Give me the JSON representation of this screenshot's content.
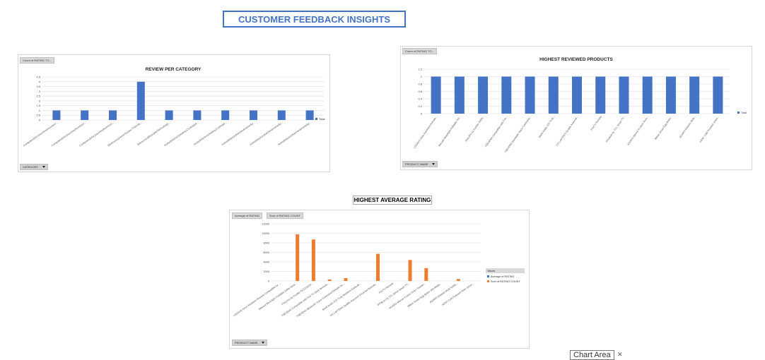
{
  "dashboard": {
    "title": "CUSTOMER FEEDBACK INSIGHTS",
    "third_chart_heading": "HIGHEST AVERAGE RATING",
    "tooltip": "Chart Area"
  },
  "colors": {
    "blue": "#4472c4",
    "orange": "#ed7d31",
    "grid": "#d9d9d9"
  },
  "chart_data": [
    {
      "type": "bar",
      "title": "REVIEW PER CATEGORY",
      "field_button": "Count of RATING TO...",
      "axis_button": "CATEGORY",
      "ylim": [
        0,
        4.5
      ],
      "yticks": [
        "0",
        "0.5",
        "1",
        "1.5",
        "2",
        "2.5",
        "3",
        "3.5",
        "4",
        "4.5"
      ],
      "categories": [
        "Computers&Accessories|Accessori...",
        "Computers&Accessories|Accessori...",
        "Computers&Accessories|Accessori...",
        "Electronics|HomeTheater,TV&Vide...",
        "Electronics|WearableTechnology|...",
        "Home&Kitchen|Heating,Cooling&A...",
        "Home&Kitchen|Heating,Cooling&...",
        "Home&Kitchen|Kitchen&HomeAp...",
        "Home&Kitchen|Kitchen&HomeAp...",
        "Home&Kitchen|Kitchen&HomeAp..."
      ],
      "series": [
        {
          "name": "Total",
          "values": [
            1,
            1,
            1,
            4,
            1,
            1,
            1,
            1,
            1,
            1
          ]
        }
      ],
      "grid": true,
      "legend": "right"
    },
    {
      "type": "bar",
      "title": "HIGHEST REVIEWED PRODUCTS",
      "field_button": "Count of RATING TO...",
      "axis_button": "PRODUCT NAME",
      "ylim": [
        0,
        1.2
      ],
      "yticks": [
        "0",
        "0.2",
        "0.4",
        "0.6",
        "0.8",
        "1",
        "1.2"
      ],
      "categories": [
        "LOHAYA Voice Assistant Remote...",
        "Wecool Moonlight Foldable Sel...",
        "PHILIPS Air Purifier 3000i...",
        "7SEVEN® Compatible with Fire...",
        "7SEVEN® Bluetooth Voice Command...",
        "Boult Audio Z20 Truly...",
        "CS LAPTEKS Quality Assured...",
        "FireTV Remote",
        "iFFalcon by TCL Smart TV...",
        "AGARO Marvel 9 Liters Oven...",
        "Milton Smart Egg Boiler...",
        "AGARO Esteem Multi...",
        "KENT Cold Pressed Juicer..."
      ],
      "series": [
        {
          "name": "Total",
          "values": [
            1,
            1,
            1,
            1,
            1,
            1,
            1,
            1,
            1,
            1,
            1,
            1,
            1
          ]
        }
      ],
      "grid": true,
      "legend": "right"
    },
    {
      "type": "bar",
      "title": "",
      "field_buttons": [
        "Average of RATING",
        "Sum of RATING COUNT"
      ],
      "axis_button": "PRODUCT NAME",
      "ylim": [
        0,
        12000
      ],
      "yticks": [
        "0",
        "2000",
        "4000",
        "6000",
        "8000",
        "10000",
        "12000"
      ],
      "categories": [
        "LOHAYA Voice Assistant Remote Compatible for ...",
        "Wecool Moonlight Foldable Selfie Stick...",
        "PHILIPS Air Purifier AC1215/20...",
        "7SEVEN® Compatible with Fire TV Stick Remote...",
        "7SEVEN® Bluetooth Voice Command Remote for ...",
        "Boult Audio Z20 Truly Wireless Earbuds...",
        "CS LAPTEKS Quality Assured Universal Remote...",
        "FireTV Remote",
        "iFFalcon by TCL 80cm Smart TV...",
        "AGARO Marvel 9 Liters Oven Toaster...",
        "Milton Smart Egg Boiler 360-Watts...",
        "AGARO Esteem Multi Kettle...",
        "KENT Cold Pressed Slow Juicer..."
      ],
      "series": [
        {
          "name": "Average of RATING",
          "values": [
            4.0,
            4.1,
            4.3,
            3.9,
            4.0,
            4.1,
            4.2,
            4.0,
            4.2,
            4.1,
            4.3,
            4.0,
            4.2
          ]
        },
        {
          "name": "Sum of RATING COUNT",
          "values": [
            0,
            9800,
            8700,
            300,
            600,
            0,
            5700,
            0,
            4400,
            2700,
            0,
            400,
            0
          ]
        }
      ],
      "legend_title": "Values",
      "grid": true,
      "legend": "right"
    }
  ]
}
